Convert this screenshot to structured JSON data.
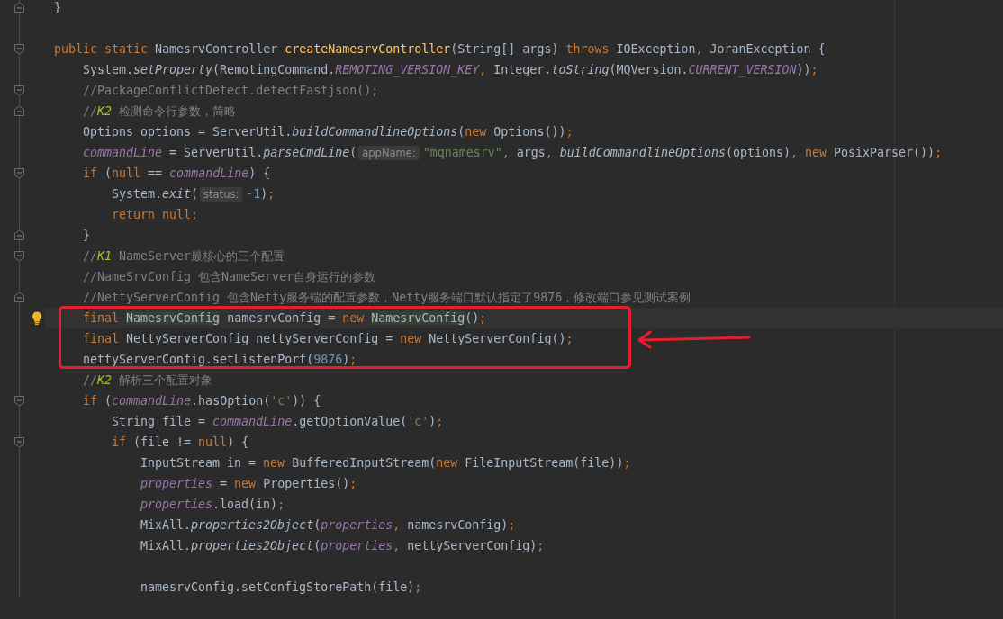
{
  "editor": {
    "lines": [
      {
        "current": false,
        "marker": {
          "kind": "end"
        },
        "tokens": [
          {
            "kind": "p",
            "text": "}"
          }
        ]
      },
      {
        "current": false
      },
      {
        "current": false,
        "marker": {
          "kind": "start"
        },
        "tokens": [
          {
            "kind": "k",
            "text": "public static "
          },
          {
            "kind": "p",
            "text": "NamesrvController "
          },
          {
            "kind": "def",
            "text": "createNamesrvController"
          },
          {
            "kind": "p",
            "text": "(String[] args) "
          },
          {
            "kind": "k",
            "text": "throws "
          },
          {
            "kind": "p",
            "text": "IOException"
          },
          {
            "kind": "k",
            "text": ", "
          },
          {
            "kind": "p",
            "text": "JoranException {"
          }
        ],
        "children": [
          {
            "current": false,
            "tokens": [
              {
                "kind": "p",
                "text": "System."
              },
              {
                "kind": "s",
                "text": "setProperty"
              },
              {
                "kind": "p",
                "text": "(RemotingCommand."
              },
              {
                "kind": "f",
                "text": "REMOTING_VERSION_KEY"
              },
              {
                "kind": "k",
                "text": ", "
              },
              {
                "kind": "p",
                "text": "Integer."
              },
              {
                "kind": "s",
                "text": "toString"
              },
              {
                "kind": "p",
                "text": "(MQVersion."
              },
              {
                "kind": "f",
                "text": "CURRENT_VERSION"
              },
              {
                "kind": "p",
                "text": "))"
              },
              {
                "kind": "k",
                "text": ";"
              }
            ]
          },
          {
            "current": false,
            "marker": {
              "kind": "start"
            },
            "tokens": [
              {
                "kind": "com",
                "text": "//PackageConflictDetect.detectFastjson();"
              }
            ]
          },
          {
            "current": false,
            "marker": {
              "kind": "end"
            },
            "tokens": [
              {
                "kind": "com",
                "text": "//"
              },
              {
                "kind": "todo",
                "text": "K2"
              },
              {
                "kind": "com",
                "text": " 检测命令行参数，简略"
              }
            ]
          },
          {
            "current": false,
            "tokens": [
              {
                "kind": "p",
                "text": "Options options = ServerUtil."
              },
              {
                "kind": "s",
                "text": "buildCommandlineOptions"
              },
              {
                "kind": "p",
                "text": "("
              },
              {
                "kind": "k",
                "text": "new "
              },
              {
                "kind": "p",
                "text": "Options())"
              },
              {
                "kind": "k",
                "text": ";"
              }
            ]
          },
          {
            "current": false,
            "tokens": [
              {
                "kind": "f",
                "text": "commandLine"
              },
              {
                "kind": "p",
                "text": " = ServerUtil."
              },
              {
                "kind": "s",
                "text": "parseCmdLine"
              },
              {
                "kind": "p",
                "text": "("
              },
              {
                "kind": "hint",
                "text": "appName:"
              },
              {
                "kind": "str",
                "text": "\"mqnamesrv\""
              },
              {
                "kind": "k",
                "text": ", "
              },
              {
                "kind": "p",
                "text": "args"
              },
              {
                "kind": "k",
                "text": ", "
              },
              {
                "kind": "s",
                "text": "buildCommandlineOptions"
              },
              {
                "kind": "p",
                "text": "(options)"
              },
              {
                "kind": "k",
                "text": ", new "
              },
              {
                "kind": "p",
                "text": "PosixParser())"
              },
              {
                "kind": "k",
                "text": ";"
              }
            ]
          },
          {
            "current": false,
            "marker": {
              "kind": "start"
            },
            "tokens": [
              {
                "kind": "k",
                "text": "if "
              },
              {
                "kind": "p",
                "text": "("
              },
              {
                "kind": "k",
                "text": "null "
              },
              {
                "kind": "p",
                "text": "== "
              },
              {
                "kind": "f",
                "text": "commandLine"
              },
              {
                "kind": "p",
                "text": ") {"
              }
            ],
            "children": [
              {
                "current": false,
                "tokens": [
                  {
                    "kind": "p",
                    "text": "System."
                  },
                  {
                    "kind": "s",
                    "text": "exit"
                  },
                  {
                    "kind": "p",
                    "text": "("
                  },
                  {
                    "kind": "hint",
                    "text": "status:"
                  },
                  {
                    "kind": "num",
                    "text": "-1"
                  },
                  {
                    "kind": "p",
                    "text": ")"
                  },
                  {
                    "kind": "k",
                    "text": ";"
                  }
                ]
              },
              {
                "current": false,
                "tokens": [
                  {
                    "kind": "k",
                    "text": "return null;"
                  }
                ]
              }
            ]
          },
          {
            "current": false,
            "marker": {
              "kind": "end"
            },
            "tokens": [
              {
                "kind": "p",
                "text": "}"
              }
            ]
          },
          {
            "current": false,
            "marker": {
              "kind": "start"
            },
            "tokens": [
              {
                "kind": "com",
                "text": "//"
              },
              {
                "kind": "todo",
                "text": "K1"
              },
              {
                "kind": "com",
                "text": " NameServer最核心的三个配置"
              }
            ]
          },
          {
            "current": false,
            "tokens": [
              {
                "kind": "com",
                "text": "//NameSrvConfig 包含NameServer自身运行的参数"
              }
            ]
          },
          {
            "current": false,
            "marker": {
              "kind": "end"
            },
            "tokens": [
              {
                "kind": "com",
                "text": "//NettyServerConfig 包含Netty服务端的配置参数，Netty服务端口默认指定了9876，修改端口参见测试案例"
              }
            ]
          },
          {
            "current": true,
            "tokens": [
              {
                "kind": "k",
                "text": "final "
              },
              {
                "kind": "hl",
                "text": "NamesrvConfig"
              },
              {
                "kind": "p",
                "text": " namesrvConfig = "
              },
              {
                "kind": "k",
                "text": "new "
              },
              {
                "kind": "hl",
                "text": "NamesrvConfig"
              },
              {
                "kind": "p",
                "text": "()"
              },
              {
                "kind": "k",
                "text": ";"
              }
            ]
          },
          {
            "current": false,
            "tokens": [
              {
                "kind": "k",
                "text": "final "
              },
              {
                "kind": "p",
                "text": "NettyServerConfig nettyServerConfig = "
              },
              {
                "kind": "k",
                "text": "new "
              },
              {
                "kind": "p",
                "text": "NettyServerConfig()"
              },
              {
                "kind": "k",
                "text": ";"
              }
            ]
          },
          {
            "current": false,
            "tokens": [
              {
                "kind": "p",
                "text": "nettyServerConfig.setListenPort("
              },
              {
                "kind": "num",
                "text": "9876"
              },
              {
                "kind": "p",
                "text": ")"
              },
              {
                "kind": "k",
                "text": ";"
              }
            ]
          },
          {
            "current": false,
            "tokens": [
              {
                "kind": "com",
                "text": "//"
              },
              {
                "kind": "todo",
                "text": "K2"
              },
              {
                "kind": "com",
                "text": " 解析三个配置对象"
              }
            ]
          },
          {
            "current": false,
            "marker": {
              "kind": "start"
            },
            "tokens": [
              {
                "kind": "k",
                "text": "if "
              },
              {
                "kind": "p",
                "text": "("
              },
              {
                "kind": "f",
                "text": "commandLine"
              },
              {
                "kind": "p",
                "text": ".hasOption("
              },
              {
                "kind": "str",
                "text": "'c'"
              },
              {
                "kind": "p",
                "text": ")) {"
              }
            ],
            "children": [
              {
                "current": false,
                "tokens": [
                  {
                    "kind": "p",
                    "text": "String file = "
                  },
                  {
                    "kind": "f",
                    "text": "commandLine"
                  },
                  {
                    "kind": "p",
                    "text": ".getOptionValue("
                  },
                  {
                    "kind": "str",
                    "text": "'c'"
                  },
                  {
                    "kind": "p",
                    "text": ")"
                  },
                  {
                    "kind": "k",
                    "text": ";"
                  }
                ]
              },
              {
                "current": false,
                "marker": {
                  "kind": "start"
                },
                "tokens": [
                  {
                    "kind": "k",
                    "text": "if "
                  },
                  {
                    "kind": "p",
                    "text": "(file != "
                  },
                  {
                    "kind": "k",
                    "text": "null"
                  },
                  {
                    "kind": "p",
                    "text": ") {"
                  }
                ],
                "children": [
                  {
                    "current": false,
                    "tokens": [
                      {
                        "kind": "p",
                        "text": "InputStream in = "
                      },
                      {
                        "kind": "k",
                        "text": "new "
                      },
                      {
                        "kind": "p",
                        "text": "BufferedInputStream("
                      },
                      {
                        "kind": "k",
                        "text": "new "
                      },
                      {
                        "kind": "p",
                        "text": "FileInputStream(file))"
                      },
                      {
                        "kind": "k",
                        "text": ";"
                      }
                    ]
                  },
                  {
                    "current": false,
                    "tokens": [
                      {
                        "kind": "f",
                        "text": "properties"
                      },
                      {
                        "kind": "p",
                        "text": " = "
                      },
                      {
                        "kind": "k",
                        "text": "new "
                      },
                      {
                        "kind": "p",
                        "text": "Properties()"
                      },
                      {
                        "kind": "k",
                        "text": ";"
                      }
                    ]
                  },
                  {
                    "current": false,
                    "tokens": [
                      {
                        "kind": "f",
                        "text": "properties"
                      },
                      {
                        "kind": "p",
                        "text": ".load(in)"
                      },
                      {
                        "kind": "k",
                        "text": ";"
                      }
                    ]
                  },
                  {
                    "current": false,
                    "tokens": [
                      {
                        "kind": "p",
                        "text": "MixAll."
                      },
                      {
                        "kind": "s",
                        "text": "properties2Object"
                      },
                      {
                        "kind": "p",
                        "text": "("
                      },
                      {
                        "kind": "f",
                        "text": "properties"
                      },
                      {
                        "kind": "k",
                        "text": ", "
                      },
                      {
                        "kind": "p",
                        "text": "namesrvConfig)"
                      },
                      {
                        "kind": "k",
                        "text": ";"
                      }
                    ]
                  },
                  {
                    "current": false,
                    "tokens": [
                      {
                        "kind": "p",
                        "text": "MixAll."
                      },
                      {
                        "kind": "s",
                        "text": "properties2Object"
                      },
                      {
                        "kind": "p",
                        "text": "("
                      },
                      {
                        "kind": "f",
                        "text": "properties"
                      },
                      {
                        "kind": "k",
                        "text": ", "
                      },
                      {
                        "kind": "p",
                        "text": "nettyServerConfig)"
                      },
                      {
                        "kind": "k",
                        "text": ";"
                      }
                    ]
                  },
                  {
                    "current": false
                  },
                  {
                    "current": false,
                    "tokens": [
                      {
                        "kind": "p",
                        "text": "namesrvConfig.setConfigStorePath(file)"
                      },
                      {
                        "kind": "k",
                        "text": ";"
                      }
                    ]
                  }
                ]
              }
            ]
          }
        ]
      }
    ]
  }
}
